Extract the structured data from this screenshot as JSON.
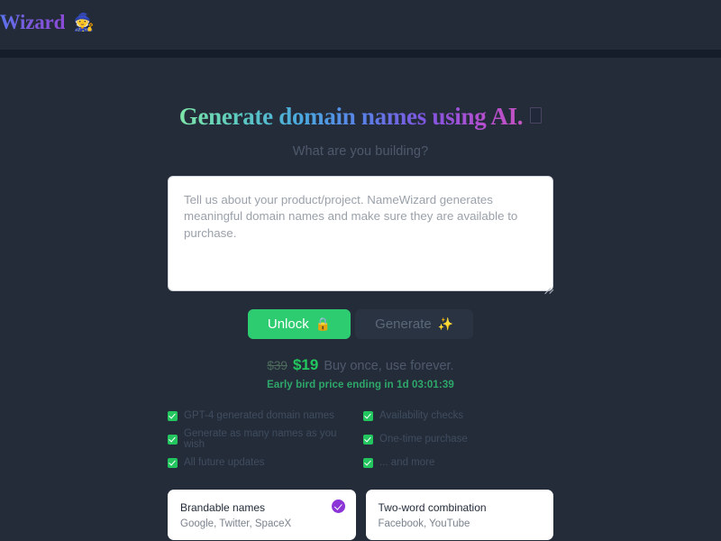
{
  "colors": {
    "page_bg": "#242c3a",
    "header_bg": "#232b39",
    "divider": "#151d2a",
    "accent_green": "#22c55e",
    "accent_purple": "#8b35d6",
    "muted_text": "#4e5a6b",
    "card_bg": "#ffffff"
  },
  "header": {
    "brand_name": "NameWizard",
    "brand_emoji": "🧙"
  },
  "hero": {
    "title": "Generate domain names using AI.",
    "title_trailing_glyph": "",
    "subtitle": "What are you building?"
  },
  "prompt": {
    "placeholder": "Tell us about your product/project. NameWizard generates meaningful domain names and make sure they are available to purchase.",
    "value": ""
  },
  "actions": {
    "unlock_label": "Unlock",
    "unlock_emoji": "🔒",
    "generate_label": "Generate",
    "generate_emoji": "✨"
  },
  "pricing": {
    "old_price": "$39",
    "new_price": "$19",
    "note": "Buy once, use forever.",
    "countdown": "Early bird price ending in 1d 03:01:39"
  },
  "features": [
    "GPT-4 generated domain names",
    "Availability checks",
    "Generate as many names as you wish",
    "One-time purchase",
    "All future updates",
    "... and more"
  ],
  "cards": [
    {
      "title": "Brandable names",
      "examples": "Google, Twitter, SpaceX",
      "selected": true
    },
    {
      "title": "Two-word combination",
      "examples": "Facebook, YouTube",
      "selected": false
    }
  ]
}
